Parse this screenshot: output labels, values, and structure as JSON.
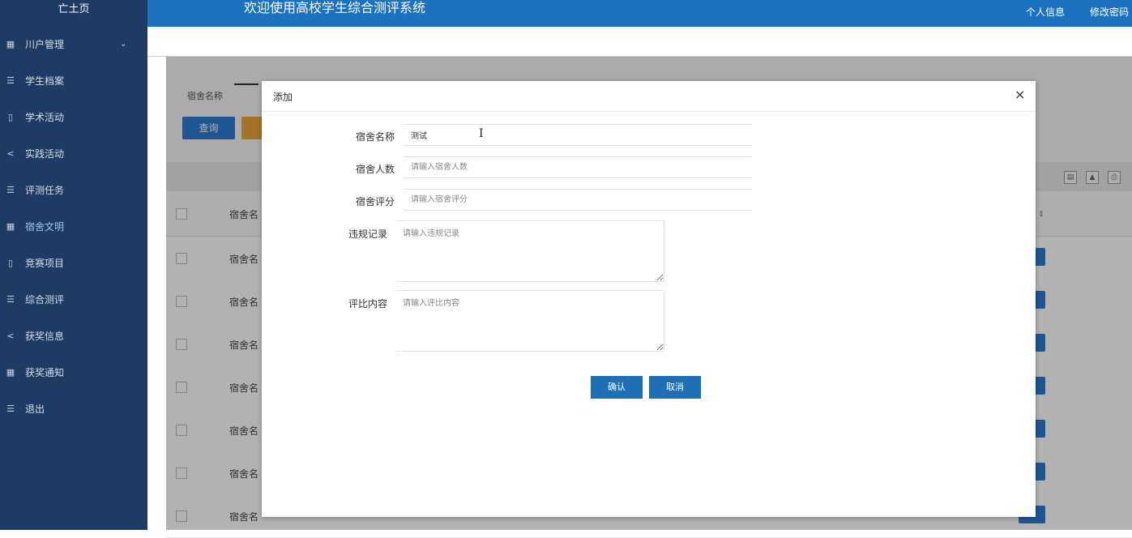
{
  "app": {
    "brand": "亡土页",
    "title": "欢迎使用高校学生综合测评系统",
    "header_links": [
      "个人信息",
      "修改密码"
    ]
  },
  "sidebar": {
    "items": [
      {
        "label": "川户管理",
        "icon": "grid-icon",
        "glyph": "▦",
        "has_chevron": true
      },
      {
        "label": "学生档案",
        "icon": "list-icon",
        "glyph": "☰"
      },
      {
        "label": "学术活动",
        "icon": "book-icon",
        "glyph": "▯"
      },
      {
        "label": "实践活动",
        "icon": "share-icon",
        "glyph": "<"
      },
      {
        "label": "评测任务",
        "icon": "list-icon",
        "glyph": "☰"
      },
      {
        "label": "宿舍文明",
        "icon": "grid-icon",
        "glyph": "▦",
        "active": true
      },
      {
        "label": "竞赛项目",
        "icon": "book-icon",
        "glyph": "▯"
      },
      {
        "label": "综合测评",
        "icon": "list-icon",
        "glyph": "☰"
      },
      {
        "label": "获奖信息",
        "icon": "share-icon",
        "glyph": "<"
      },
      {
        "label": "获奖通知",
        "icon": "grid-icon",
        "glyph": "▦"
      },
      {
        "label": "退出",
        "icon": "list-icon",
        "glyph": "☰"
      }
    ],
    "chevron": "⌄"
  },
  "content": {
    "search_label": "宿舍名称",
    "query_button": "查询",
    "table_header_first": "宿舍名",
    "rows": [
      "宿舍名",
      "宿舍名",
      "宿舍名",
      "宿舍名",
      "宿舍名",
      "宿舍名",
      "宿舍名"
    ]
  },
  "modal": {
    "title": "添加",
    "close": "×",
    "fields": {
      "dorm_name": {
        "label": "宿舍名称",
        "value": "测试"
      },
      "dorm_count": {
        "label": "宿舍人数",
        "placeholder": "请输入宿舍人数"
      },
      "dorm_score": {
        "label": "宿舍评分",
        "placeholder": "请输入宿舍评分"
      },
      "violation": {
        "label": "违规记录",
        "placeholder": "请输入违规记录"
      },
      "compare": {
        "label": "评比内容",
        "placeholder": "请输入评比内容"
      }
    },
    "confirm": "确认",
    "cancel": "取消"
  },
  "colors": {
    "sidebar": "#1d3b63",
    "header": "#1d72c0",
    "primary_button": "#1f6fb4",
    "accent_orange": "#e9a53b"
  }
}
